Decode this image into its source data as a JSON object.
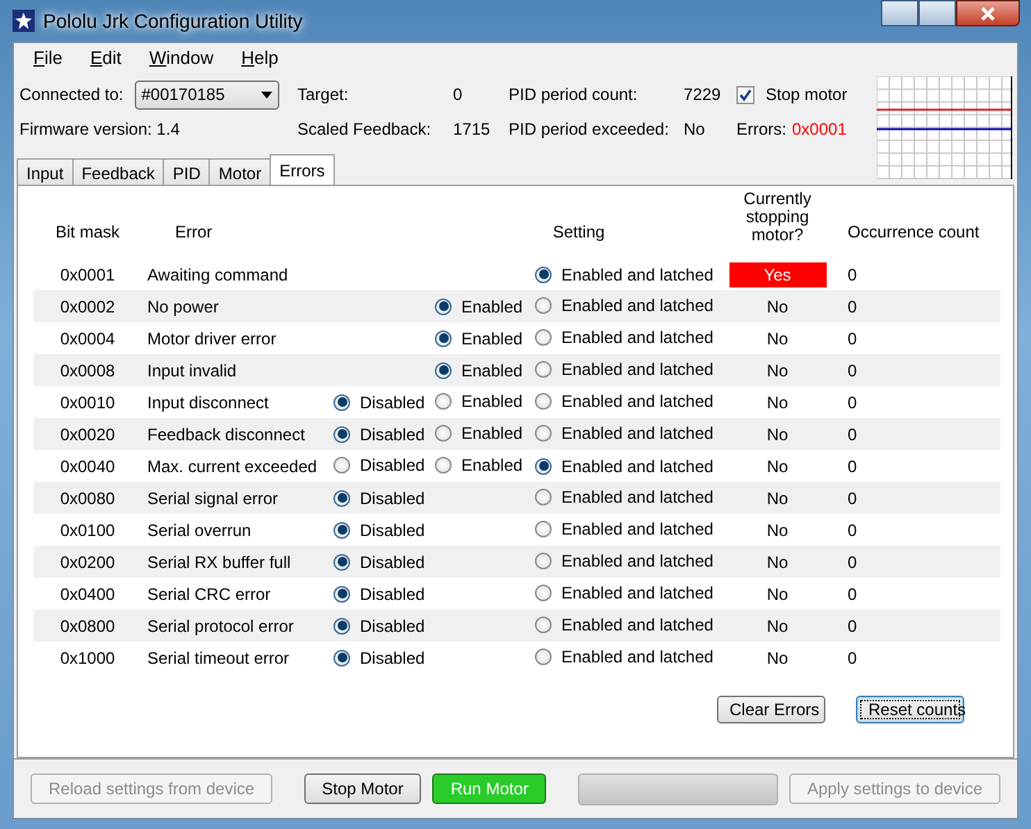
{
  "window": {
    "title": "Pololu Jrk Configuration Utility"
  },
  "menu": [
    {
      "label": "File"
    },
    {
      "label": "Edit"
    },
    {
      "label": "Window"
    },
    {
      "label": "Help"
    }
  ],
  "status": {
    "connected_label": "Connected to:",
    "device": "#00170185",
    "firmware": "Firmware version: 1.4",
    "fields": [
      {
        "label": "Target:",
        "value": "0"
      },
      {
        "label": "Scaled Feedback:",
        "value": "1715"
      },
      {
        "label": "PID period count:",
        "value": "7229"
      },
      {
        "label": "PID period exceeded:",
        "value": "No"
      }
    ],
    "stop_motor": {
      "label": "Stop motor",
      "checked": true
    },
    "errors_label": "Errors:",
    "errors_value": "0x0001"
  },
  "tabs": [
    {
      "label": "Input",
      "selected": false
    },
    {
      "label": "Feedback",
      "selected": false
    },
    {
      "label": "PID",
      "selected": false
    },
    {
      "label": "Motor",
      "selected": false
    },
    {
      "label": "Errors",
      "selected": true
    }
  ],
  "table": {
    "columns": [
      "Bit mask",
      "Error",
      "Setting",
      "Currently stopping motor?",
      "Occurrence count"
    ],
    "rows": [
      {
        "mask": "0x0001",
        "error": "Awaiting command",
        "options": {
          "latched": {
            "label": "Enabled and latched",
            "selected": true
          }
        },
        "stopping": {
          "text": "Yes",
          "active": true
        },
        "count": "0"
      },
      {
        "mask": "0x0002",
        "error": "No power",
        "options": {
          "enabled": {
            "label": "Enabled",
            "selected": true
          },
          "latched": {
            "label": "Enabled and latched",
            "selected": false
          }
        },
        "stopping": {
          "text": "No",
          "active": false
        },
        "count": "0"
      },
      {
        "mask": "0x0004",
        "error": "Motor driver error",
        "options": {
          "enabled": {
            "label": "Enabled",
            "selected": true
          },
          "latched": {
            "label": "Enabled and latched",
            "selected": false
          }
        },
        "stopping": {
          "text": "No",
          "active": false
        },
        "count": "0"
      },
      {
        "mask": "0x0008",
        "error": "Input invalid",
        "options": {
          "enabled": {
            "label": "Enabled",
            "selected": true
          },
          "latched": {
            "label": "Enabled and latched",
            "selected": false
          }
        },
        "stopping": {
          "text": "No",
          "active": false
        },
        "count": "0"
      },
      {
        "mask": "0x0010",
        "error": "Input disconnect",
        "options": {
          "disabled": {
            "label": "Disabled",
            "selected": true
          },
          "enabled": {
            "label": "Enabled",
            "selected": false
          },
          "latched": {
            "label": "Enabled and latched",
            "selected": false
          }
        },
        "stopping": {
          "text": "No",
          "active": false
        },
        "count": "0"
      },
      {
        "mask": "0x0020",
        "error": "Feedback disconnect",
        "options": {
          "disabled": {
            "label": "Disabled",
            "selected": true
          },
          "enabled": {
            "label": "Enabled",
            "selected": false
          },
          "latched": {
            "label": "Enabled and latched",
            "selected": false
          }
        },
        "stopping": {
          "text": "No",
          "active": false
        },
        "count": "0"
      },
      {
        "mask": "0x0040",
        "error": "Max. current exceeded",
        "options": {
          "disabled": {
            "label": "Disabled",
            "selected": false
          },
          "enabled": {
            "label": "Enabled",
            "selected": false
          },
          "latched": {
            "label": "Enabled and latched",
            "selected": true
          }
        },
        "stopping": {
          "text": "No",
          "active": false
        },
        "count": "0"
      },
      {
        "mask": "0x0080",
        "error": "Serial signal error",
        "options": {
          "disabled": {
            "label": "Disabled",
            "selected": true
          },
          "latched": {
            "label": "Enabled and latched",
            "selected": false
          }
        },
        "stopping": {
          "text": "No",
          "active": false
        },
        "count": "0"
      },
      {
        "mask": "0x0100",
        "error": "Serial overrun",
        "options": {
          "disabled": {
            "label": "Disabled",
            "selected": true
          },
          "latched": {
            "label": "Enabled and latched",
            "selected": false
          }
        },
        "stopping": {
          "text": "No",
          "active": false
        },
        "count": "0"
      },
      {
        "mask": "0x0200",
        "error": "Serial RX buffer full",
        "options": {
          "disabled": {
            "label": "Disabled",
            "selected": true
          },
          "latched": {
            "label": "Enabled and latched",
            "selected": false
          }
        },
        "stopping": {
          "text": "No",
          "active": false
        },
        "count": "0"
      },
      {
        "mask": "0x0400",
        "error": "Serial CRC error",
        "options": {
          "disabled": {
            "label": "Disabled",
            "selected": true
          },
          "latched": {
            "label": "Enabled and latched",
            "selected": false
          }
        },
        "stopping": {
          "text": "No",
          "active": false
        },
        "count": "0"
      },
      {
        "mask": "0x0800",
        "error": "Serial protocol error",
        "options": {
          "disabled": {
            "label": "Disabled",
            "selected": true
          },
          "latched": {
            "label": "Enabled and latched",
            "selected": false
          }
        },
        "stopping": {
          "text": "No",
          "active": false
        },
        "count": "0"
      },
      {
        "mask": "0x1000",
        "error": "Serial timeout error",
        "options": {
          "disabled": {
            "label": "Disabled",
            "selected": true
          },
          "latched": {
            "label": "Enabled and latched",
            "selected": false
          }
        },
        "stopping": {
          "text": "No",
          "active": false
        },
        "count": "0"
      }
    ]
  },
  "panel_buttons": [
    {
      "label": "Clear Errors",
      "focused": false
    },
    {
      "label": "Reset counts",
      "focused": true
    }
  ],
  "bottom_buttons": [
    {
      "kind": "button",
      "label": "Reload settings from device",
      "disabled": true
    },
    {
      "kind": "spacer"
    },
    {
      "kind": "button",
      "label": "Stop Motor",
      "disabled": false
    },
    {
      "kind": "run",
      "label": "Run Motor",
      "disabled": false
    },
    {
      "kind": "spacer"
    },
    {
      "kind": "blank"
    },
    {
      "kind": "button",
      "label": "Apply settings to device",
      "disabled": true
    }
  ]
}
